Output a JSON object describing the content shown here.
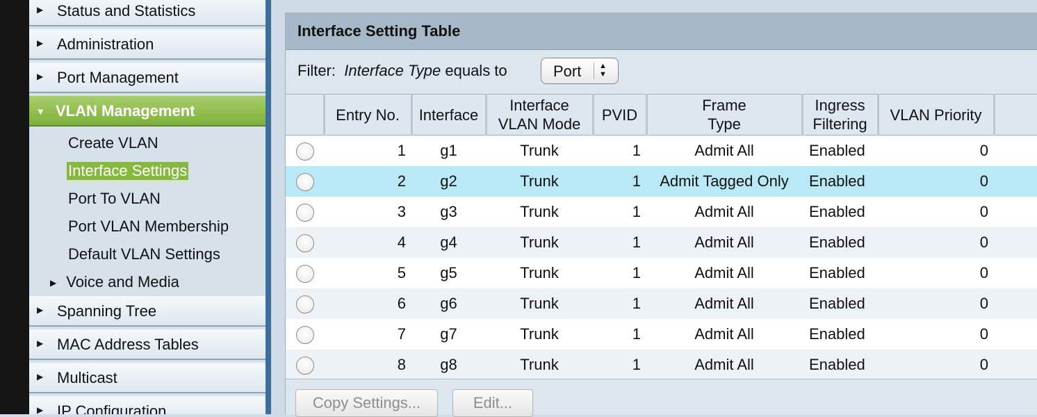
{
  "sidebar": {
    "top_items": [
      {
        "label": "Status and Statistics"
      },
      {
        "label": "Administration"
      },
      {
        "label": "Port Management"
      }
    ],
    "active_item": {
      "label": "VLAN Management"
    },
    "sub_items": [
      {
        "label": "Create VLAN"
      },
      {
        "label": "Interface Settings"
      },
      {
        "label": "Port To VLAN"
      },
      {
        "label": "Port VLAN Membership"
      },
      {
        "label": "Default VLAN Settings"
      }
    ],
    "sub_group": {
      "label": "Voice and Media"
    },
    "bottom_items": [
      {
        "label": "Spanning Tree"
      },
      {
        "label": "MAC Address Tables"
      },
      {
        "label": "Multicast"
      },
      {
        "label": "IP Configuration"
      }
    ],
    "colors": {
      "active_bg": "#8dbf45",
      "selected_sub_bg": "#86b83e",
      "separator": "#3a6f9e"
    }
  },
  "panel": {
    "title": "Interface Setting Table",
    "filter": {
      "prefix": "Filter:",
      "field": "Interface Type",
      "operator": "equals to",
      "selected": "Port"
    },
    "columns": {
      "entry_no": "Entry No.",
      "interface": "Interface",
      "mode_1": "Interface",
      "mode_2": "VLAN Mode",
      "pvid": "PVID",
      "frame_1": "Frame",
      "frame_2": "Type",
      "ingress_1": "Ingress",
      "ingress_2": "Filtering",
      "priority": "VLAN Priority"
    },
    "rows": [
      {
        "entry": "1",
        "interface": "g1",
        "mode": "Trunk",
        "pvid": "1",
        "frame": "Admit All",
        "ingress": "Enabled",
        "priority": "0"
      },
      {
        "entry": "2",
        "interface": "g2",
        "mode": "Trunk",
        "pvid": "1",
        "frame": "Admit Tagged Only",
        "ingress": "Enabled",
        "priority": "0"
      },
      {
        "entry": "3",
        "interface": "g3",
        "mode": "Trunk",
        "pvid": "1",
        "frame": "Admit All",
        "ingress": "Enabled",
        "priority": "0"
      },
      {
        "entry": "4",
        "interface": "g4",
        "mode": "Trunk",
        "pvid": "1",
        "frame": "Admit All",
        "ingress": "Enabled",
        "priority": "0"
      },
      {
        "entry": "5",
        "interface": "g5",
        "mode": "Trunk",
        "pvid": "1",
        "frame": "Admit All",
        "ingress": "Enabled",
        "priority": "0"
      },
      {
        "entry": "6",
        "interface": "g6",
        "mode": "Trunk",
        "pvid": "1",
        "frame": "Admit All",
        "ingress": "Enabled",
        "priority": "0"
      },
      {
        "entry": "7",
        "interface": "g7",
        "mode": "Trunk",
        "pvid": "1",
        "frame": "Admit All",
        "ingress": "Enabled",
        "priority": "0"
      },
      {
        "entry": "8",
        "interface": "g8",
        "mode": "Trunk",
        "pvid": "1",
        "frame": "Admit All",
        "ingress": "Enabled",
        "priority": "0"
      }
    ],
    "buttons": {
      "copy": "Copy Settings...",
      "edit": "Edit..."
    },
    "colors": {
      "header_bg": "#a7b9c9",
      "highlight_row": "#b9e9f6"
    }
  }
}
